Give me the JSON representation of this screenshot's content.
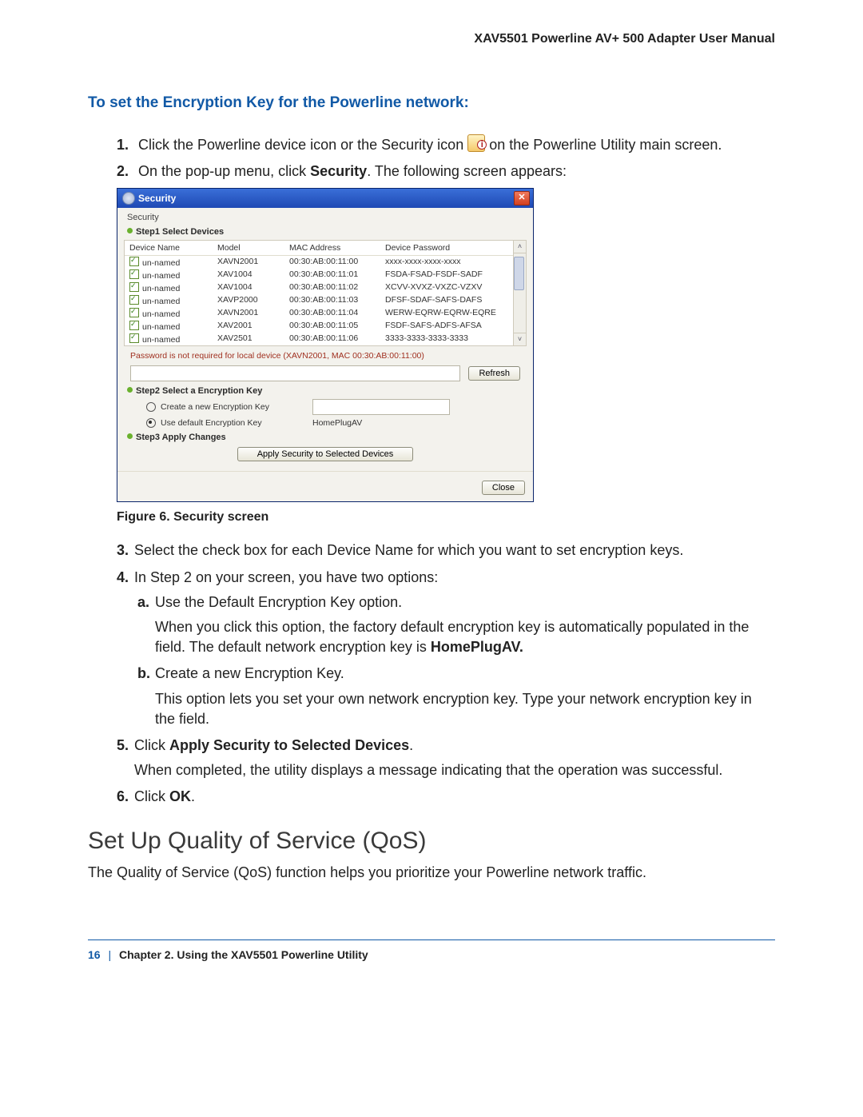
{
  "header": {
    "title": "XAV5501 Powerline AV+ 500 Adapter User Manual"
  },
  "heading": "To set the Encryption Key for the Powerline network:",
  "steps": {
    "s1a": "Click the Powerline device icon or the Security icon",
    "s1b": "on the Powerline Utility main screen.",
    "s2a": "On the pop-up menu, click ",
    "s2bold": "Security",
    "s2b": ". The following screen appears:",
    "s3": "Select the check box for each Device Name for which you want to set encryption keys.",
    "s4": "In Step 2 on your screen, you have two options:",
    "s4a": "Use the Default Encryption Key option.",
    "s4a_p1a": "When you click this option, the factory default encryption key is automatically populated in the field. The default network encryption key is ",
    "s4a_p1bold": "HomePlugAV.",
    "s4b": "Create a new Encryption Key.",
    "s4b_p": "This option lets you set your own network encryption key. Type your network encryption key in the field.",
    "s5a": "Click ",
    "s5bold": "Apply Security to Selected Devices",
    "s5b": ".",
    "s5_p": "When completed, the utility displays a message indicating that the operation was successful.",
    "s6a": "Click ",
    "s6bold": "OK",
    "s6b": "."
  },
  "fig": {
    "caption": "Figure 6.  Security screen",
    "title": "Security",
    "menu": "Security",
    "step1": "Step1   Select Devices",
    "step2": "Step2   Select a Encryption Key",
    "step3": "Step3   Apply Changes",
    "cols": {
      "c1": "Device Name",
      "c2": "Model",
      "c3": "MAC Address",
      "c4": "Device Password"
    },
    "rows": [
      {
        "name": "un-named",
        "model": "XAVN2001",
        "mac": "00:30:AB:00:11:00",
        "pwd": "xxxx-xxxx-xxxx-xxxx"
      },
      {
        "name": "un-named",
        "model": "XAV1004",
        "mac": "00:30:AB:00:11:01",
        "pwd": "FSDA-FSAD-FSDF-SADF"
      },
      {
        "name": "un-named",
        "model": "XAV1004",
        "mac": "00:30:AB:00:11:02",
        "pwd": "XCVV-XVXZ-VXZC-VZXV"
      },
      {
        "name": "un-named",
        "model": "XAVP2000",
        "mac": "00:30:AB:00:11:03",
        "pwd": "DFSF-SDAF-SAFS-DAFS"
      },
      {
        "name": "un-named",
        "model": "XAVN2001",
        "mac": "00:30:AB:00:11:04",
        "pwd": "WERW-EQRW-EQRW-EQRE"
      },
      {
        "name": "un-named",
        "model": "XAV2001",
        "mac": "00:30:AB:00:11:05",
        "pwd": "FSDF-SAFS-ADFS-AFSA"
      },
      {
        "name": "un-named",
        "model": "XAV2501",
        "mac": "00:30:AB:00:11:06",
        "pwd": "3333-3333-3333-3333"
      }
    ],
    "note": "Password is not required for local device (XAVN2001, MAC 00:30:AB:00:11:00)",
    "refresh": "Refresh",
    "optCreate": "Create a new Encryption Key",
    "optDefault": "Use default Encryption Key",
    "defaultKey": "HomePlugAV",
    "apply": "Apply Security to Selected Devices",
    "close": "Close"
  },
  "qos": {
    "title": "Set Up Quality of Service (QoS)",
    "body": "The Quality of Service (QoS) function helps you prioritize your Powerline network traffic."
  },
  "footer": {
    "page": "16",
    "chapter": "Chapter 2.  Using the XAV5501 Powerline Utility"
  }
}
